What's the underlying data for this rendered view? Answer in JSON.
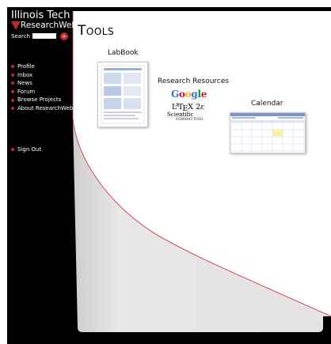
{
  "brand": {
    "line1": "Illinois Tech",
    "line2": "ResearchWeb"
  },
  "search": {
    "label": "Search",
    "value": "",
    "button_glyph": "»"
  },
  "nav_items": [
    {
      "label": "Profile"
    },
    {
      "label": "Inbox"
    },
    {
      "label": "News"
    },
    {
      "label": "Forum"
    },
    {
      "label": "Browse Projects"
    },
    {
      "label": "About ResearchWeb"
    }
  ],
  "signout": {
    "label": "Sign Out"
  },
  "page": {
    "title": "Tools"
  },
  "tools": {
    "labbook": {
      "label": "LabBook"
    },
    "research": {
      "label": "Research Resources",
      "google": "Google",
      "latex": "LATEX 2ε",
      "sci_line1": "Scientific",
      "sci_line2": "FORMATTING"
    },
    "calendar": {
      "label": "Calendar"
    }
  },
  "colors": {
    "brand_red": "#c8262b",
    "frame_black": "#000000",
    "panel_gray": "#e7e5e6",
    "google_blue": "#3369e8",
    "google_red": "#d50f25",
    "google_yellow": "#eeb211",
    "google_green": "#009925"
  }
}
